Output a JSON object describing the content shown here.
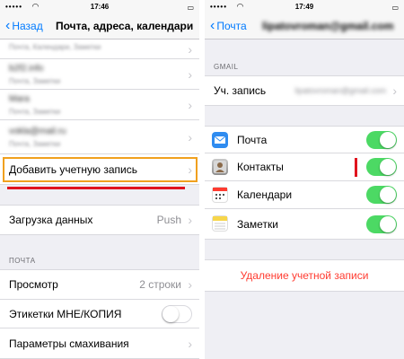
{
  "left": {
    "status": {
      "carrier": "•••••",
      "time": "17:46",
      "battery": "▭"
    },
    "nav": {
      "back_label": "Назад",
      "title": "Почта, адреса, календари"
    },
    "partial_row": {
      "subtitle": "Почта, Календари, Заметки"
    },
    "accounts": [
      {
        "name": "b2f2.info",
        "subtitle": "Почта, Заметки"
      },
      {
        "name": "Mara",
        "subtitle": "Почта, Заметки"
      },
      {
        "name": "vokla@mail.ru",
        "subtitle": "Почта, Заметки"
      }
    ],
    "add_account": "Добавить учетную запись",
    "fetch": {
      "label": "Загрузка данных",
      "value": "Push"
    },
    "mail_section": "ПОЧТА",
    "preview": {
      "label": "Просмотр",
      "value": "2 строки"
    },
    "cc_label": "Этикетки МНЕ/КОПИЯ",
    "swipe_label": "Параметры смахивания"
  },
  "right": {
    "status": {
      "carrier": "•••••",
      "time": "17:49",
      "battery": "▭"
    },
    "nav": {
      "back_label": "Почта",
      "title": "lipatovroman@gmail.com"
    },
    "section": "GMAIL",
    "account": {
      "label": "Уч. запись",
      "value": "lipatovroman@gmail.com"
    },
    "services": [
      {
        "label": "Почта",
        "icon": "mail-icon",
        "color": "#2f8cf0",
        "enabled": true
      },
      {
        "label": "Контакты",
        "icon": "contacts-icon",
        "color": "#a8a8a8",
        "enabled": true
      },
      {
        "label": "Календари",
        "icon": "calendar-icon",
        "color": "#ffffff",
        "enabled": true
      },
      {
        "label": "Заметки",
        "icon": "notes-icon",
        "color": "#f7d64a",
        "enabled": true
      }
    ],
    "delete_label": "Удаление учетной записи"
  },
  "colors": {
    "accent": "#007aff",
    "switch_on": "#4cd964",
    "highlight": "#f0a01e",
    "annotation": "#e0141e",
    "destructive": "#ff3b30"
  }
}
